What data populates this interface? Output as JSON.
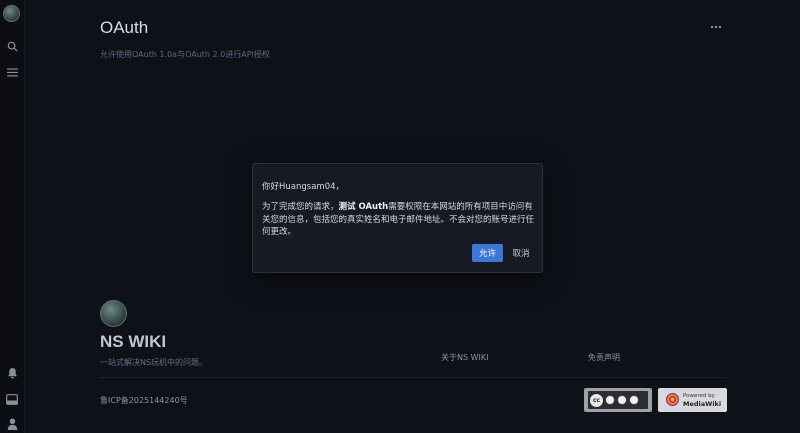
{
  "page": {
    "title": "OAuth",
    "subtitle": "允许使用OAuth 1.0a与OAuth 2.0进行API授权"
  },
  "dialog": {
    "greeting": "你好Huangsam04，",
    "message_pre": "为了完成您的请求，",
    "app_name": "测试 OAuth",
    "message_post": "需要权限在本网站的所有项目中访问有关您的信息，包括您的真实姓名和电子邮件地址。不会对您的账号进行任何更改。",
    "allow_label": "允许",
    "cancel_label": "取消",
    "accent_color": "#3f76d6"
  },
  "footer": {
    "site_name": "NS WIKI",
    "tagline": "一站式解决NS玩机中的问题。",
    "links": [
      "关于NS WIKI",
      "免责声明"
    ],
    "icp": "鲁ICP备2025144240号",
    "badges": {
      "cc_label": "cc",
      "mediawiki_line1": "Powered by",
      "mediawiki_line2": "MediaWiki"
    }
  },
  "sidebar": {
    "icons": [
      "avatar",
      "search-icon",
      "menu-icon",
      "bell-icon",
      "inbox-icon",
      "user-icon"
    ]
  }
}
